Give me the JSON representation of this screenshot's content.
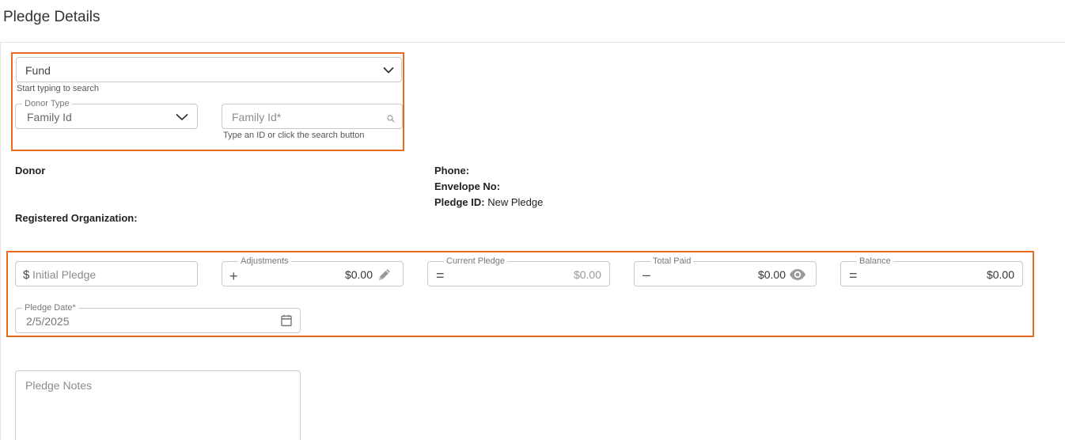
{
  "page": {
    "title": "Pledge Details"
  },
  "fund": {
    "value": "Fund",
    "helper": "Start typing to search"
  },
  "donor_type": {
    "legend": "Donor Type",
    "value": "Family Id"
  },
  "family_id": {
    "placeholder": "Family Id*",
    "helper": "Type an ID or click the search button"
  },
  "info": {
    "donor_label": "Donor",
    "registered_org_label": "Registered Organization:",
    "phone_label": "Phone:",
    "envelope_label": "Envelope No:",
    "pledge_id_label": "Pledge ID:",
    "pledge_id_value": "New Pledge"
  },
  "amounts": {
    "initial_pledge": {
      "prefix": "$",
      "placeholder": "Initial Pledge"
    },
    "adjustments": {
      "legend": "Adjustments",
      "symbol": "+",
      "value": "$0.00"
    },
    "current_pledge": {
      "legend": "Current Pledge",
      "symbol": "=",
      "value": "$0.00"
    },
    "total_paid": {
      "legend": "Total Paid",
      "symbol": "–",
      "value": "$0.00"
    },
    "balance": {
      "legend": "Balance",
      "symbol": "=",
      "value": "$0.00"
    }
  },
  "pledge_date": {
    "legend": "Pledge Date*",
    "value": "2/5/2025"
  },
  "notes": {
    "placeholder": "Pledge Notes"
  },
  "colors": {
    "highlight": "#ea6a1f",
    "border": "#c9c9c9"
  },
  "icons": {
    "fund_dropdown": "chevron-down-icon",
    "donor_type_dropdown": "chevron-down-icon",
    "family_search": "search-icon",
    "adjustments_edit": "pencil-icon",
    "total_paid_view": "eye-icon",
    "pledge_date_picker": "calendar-icon"
  }
}
